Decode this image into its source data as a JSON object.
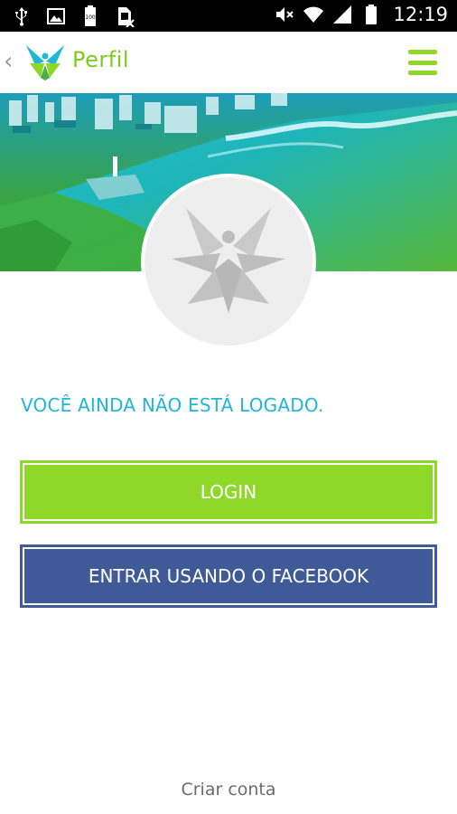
{
  "status_bar": {
    "time": "12:19",
    "battery_small_label": "100",
    "icons": [
      "usb-icon",
      "image-icon",
      "battery-100-icon",
      "sim-blocked-icon",
      "mute-icon",
      "wifi-icon",
      "signal-icon",
      "battery-icon"
    ]
  },
  "app_bar": {
    "back_icon": "chevron-left-icon",
    "title": "Perfil",
    "menu_icon": "hamburger-icon"
  },
  "profile": {
    "avatar_icon": "butterfly-placeholder-icon"
  },
  "content": {
    "notice": "VOCÊ AINDA NÃO ESTÁ LOGADO.",
    "login_label": "LOGIN",
    "facebook_label": "ENTRAR USANDO O FACEBOOK",
    "create_account": "Criar conta"
  },
  "colors": {
    "accent_green": "#8fd82a",
    "notice_blue": "#1fb6d8",
    "facebook_blue": "#3f5a97"
  }
}
